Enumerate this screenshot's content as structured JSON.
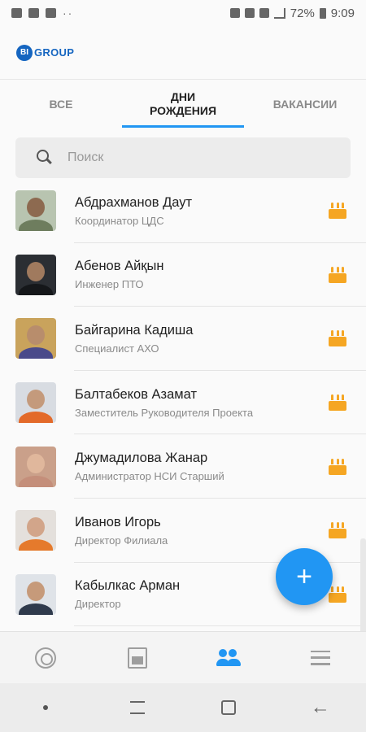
{
  "status_bar": {
    "battery": "72%",
    "time": "9:09"
  },
  "app_bar": {
    "logo_mark": "BI",
    "logo_text": "GROUP"
  },
  "tabs": [
    {
      "label": "ВСЕ",
      "active": false
    },
    {
      "label": "ДНИ\nРОЖДЕНИЯ",
      "active": true
    },
    {
      "label": "ВАКАНСИИ",
      "active": false
    }
  ],
  "search": {
    "placeholder": "Поиск",
    "value": ""
  },
  "employees": [
    {
      "name": "Абдрахманов Даут",
      "role": "Координатор ЦДС",
      "avatar_colors": {
        "bg": "#b8c4b0",
        "head": "#8d6a50",
        "body": "#6e7d5e"
      }
    },
    {
      "name": "Абенов Айқын",
      "role": "Инженер ПТО",
      "avatar_colors": {
        "bg": "#2b2e33",
        "head": "#a07a5e",
        "body": "#15171a"
      }
    },
    {
      "name": "Байгарина Кадиша",
      "role": "Специалист АХО",
      "avatar_colors": {
        "bg": "#c9a35c",
        "head": "#b88d6c",
        "body": "#4a4a8a"
      }
    },
    {
      "name": "Балтабеков Азамат",
      "role": "Заместитель Руководителя Проекта",
      "avatar_colors": {
        "bg": "#d8dce2",
        "head": "#c49a7c",
        "body": "#e36a2a"
      }
    },
    {
      "name": "Джумадилова Жанар",
      "role": "Администратор НСИ Старший",
      "avatar_colors": {
        "bg": "#caa08a",
        "head": "#e0b79c",
        "body": "#c48e7a"
      }
    },
    {
      "name": "Иванов Игорь",
      "role": "Директор Филиала",
      "avatar_colors": {
        "bg": "#e4e0dc",
        "head": "#d2a58a",
        "body": "#e57a2c"
      }
    },
    {
      "name": "Кабылкас Арман",
      "role": "Директор",
      "avatar_colors": {
        "bg": "#dfe3e8",
        "head": "#c69a7a",
        "body": "#2f3a4c"
      }
    }
  ],
  "fab": {
    "label": "+"
  },
  "bottom_nav": [
    {
      "icon": "target-icon",
      "active": false
    },
    {
      "icon": "document-icon",
      "active": false
    },
    {
      "icon": "people-icon",
      "active": true
    },
    {
      "icon": "menu-icon",
      "active": false
    }
  ],
  "colors": {
    "accent": "#2196f3",
    "cake": "#f5a623",
    "brand": "#1565c0"
  }
}
